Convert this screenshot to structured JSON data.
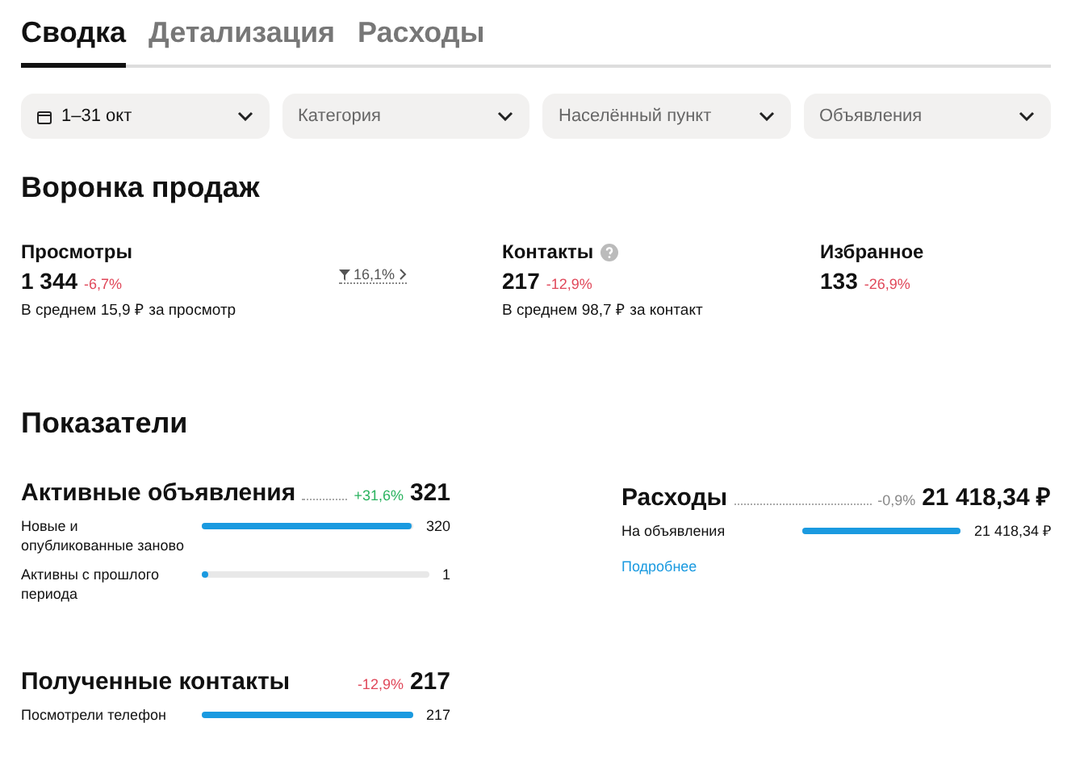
{
  "tabs": [
    {
      "label": "Сводка",
      "selected": true
    },
    {
      "label": "Детализация",
      "selected": false
    },
    {
      "label": "Расходы",
      "selected": false
    }
  ],
  "filters": [
    {
      "label": "1–31 окт",
      "kind": "date"
    },
    {
      "label": "Категория",
      "kind": "select"
    },
    {
      "label": "Населённый пункт",
      "kind": "select"
    },
    {
      "label": "Объявления",
      "kind": "select"
    }
  ],
  "funnel": {
    "title": "Воронка продаж",
    "conversion": "16,1%",
    "stages": [
      {
        "label": "Просмотры",
        "value": "1 344",
        "change": "-6,7%",
        "color": "#e0485a",
        "note": "В среднем 15,9 ₽ за просмотр",
        "help": false
      },
      {
        "label": "Контакты",
        "value": "217",
        "change": "-12,9%",
        "color": "#e0485a",
        "note": "В среднем 98,7 ₽ за контакт",
        "help": true
      },
      {
        "label": "Избранное",
        "value": "133",
        "change": "-26,9%",
        "color": "#e0485a",
        "help": false
      }
    ]
  },
  "indicators": {
    "title": "Показатели",
    "groups": [
      {
        "title": "Активные объявления",
        "change": "+31,6%",
        "color": "#2bb35f",
        "total": "321",
        "dotted": true,
        "rows": [
          {
            "label": "Новые и опубликованные заново",
            "level": 0.99,
            "value": "320"
          },
          {
            "label": "Активны с прошлого периода",
            "level": 0.03,
            "value": "1"
          }
        ]
      },
      {
        "title": "Расходы",
        "change": "-0,9%",
        "color": "#888888",
        "total": "21 418,34 ₽",
        "dotted": true,
        "rows": [
          {
            "label": "На объявления",
            "level": 1,
            "value": "21 418,34 ₽"
          }
        ],
        "link": "Подробнее"
      },
      {
        "title": "Полученные контакты",
        "change": "-12,9%",
        "color": "#e0485a",
        "total": "217",
        "dotted": false,
        "rows": [
          {
            "label": "Посмотрели телефон",
            "level": 1,
            "value": "217"
          }
        ]
      }
    ]
  }
}
